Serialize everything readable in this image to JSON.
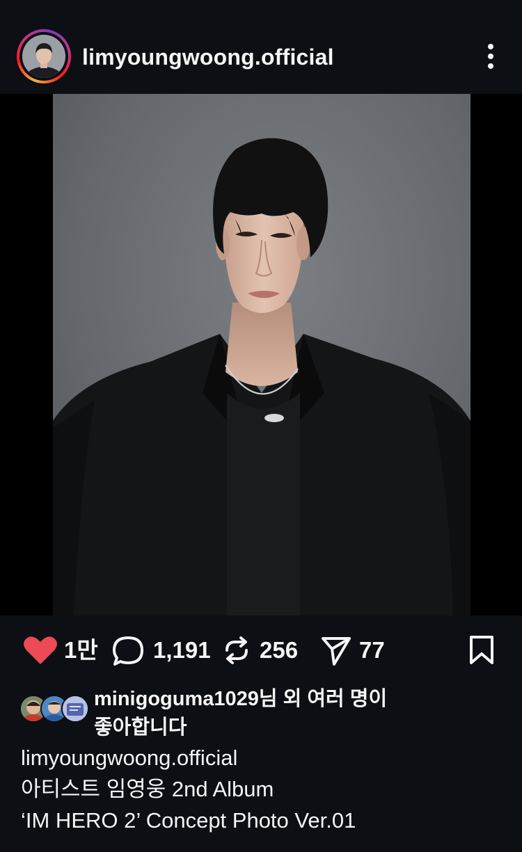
{
  "post": {
    "username": "limyoungwoong.official",
    "more_icon": "more-vertical-icon",
    "image_alt": "Concept photo of Lim Young Woong in a black suit jacket against a grey backdrop"
  },
  "actions": {
    "like": {
      "icon": "heart-filled-icon",
      "count": "1만",
      "color": "#ed4956"
    },
    "comment": {
      "icon": "comment-bubble-icon",
      "count": "1,191"
    },
    "repost": {
      "icon": "repost-icon",
      "count": "256"
    },
    "share": {
      "icon": "send-icon",
      "count": "77"
    },
    "save": {
      "icon": "bookmark-icon"
    }
  },
  "likes": {
    "text_line1": "minigoguma1029님 외 여러 명이",
    "text_line2": "좋아합니다"
  },
  "caption": {
    "username": "limyoungwoong.official",
    "line1": "아티스트 임영웅 2nd Album",
    "line2": "‘IM HERO 2’ Concept Photo Ver.01"
  },
  "colors": {
    "background": "#0c0f14",
    "text": "#f5f5f5",
    "like_red": "#ed4956"
  }
}
